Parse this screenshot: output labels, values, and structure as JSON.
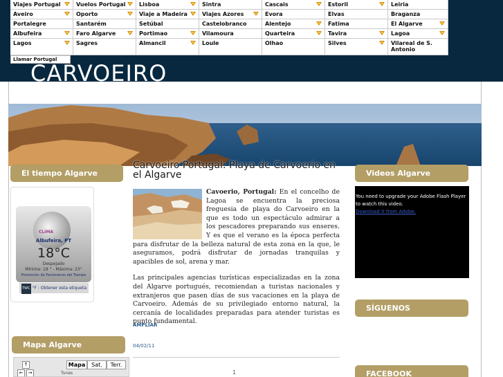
{
  "menu": {
    "rows": [
      [
        {
          "label": "Viajes Portugal",
          "arrow": true
        },
        {
          "label": "Vuelos Portugal",
          "arrow": true
        },
        {
          "label": "Lisboa",
          "arrow": true
        },
        {
          "label": "Sintra",
          "arrow": false
        },
        {
          "label": "Cascais",
          "arrow": true
        },
        {
          "label": "Estoril",
          "arrow": true
        },
        {
          "label": "Leiria",
          "arrow": false
        }
      ],
      [
        {
          "label": "Aveiro",
          "arrow": true
        },
        {
          "label": "Oporto",
          "arrow": true
        },
        {
          "label": "Viaje a Madeira",
          "arrow": true
        },
        {
          "label": "Viajes Azores",
          "arrow": true
        },
        {
          "label": "Evora",
          "arrow": false
        },
        {
          "label": "Elvas",
          "arrow": false
        },
        {
          "label": "Braganza",
          "arrow": false
        }
      ],
      [
        {
          "label": "Portalegre",
          "arrow": false
        },
        {
          "label": "Santarém",
          "arrow": false
        },
        {
          "label": "Setúbal",
          "arrow": false
        },
        {
          "label": "Castelobranco",
          "arrow": false
        },
        {
          "label": "Alentejo",
          "arrow": true
        },
        {
          "label": "Fatima",
          "arrow": false
        },
        {
          "label": "El Algarve",
          "arrow": true
        }
      ],
      [
        {
          "label": "Albufeira",
          "arrow": true
        },
        {
          "label": "Faro Algarve",
          "arrow": true
        },
        {
          "label": "Portimao",
          "arrow": true
        },
        {
          "label": "Vilamoura",
          "arrow": false
        },
        {
          "label": "Quarteira",
          "arrow": true
        },
        {
          "label": "Tavira",
          "arrow": true
        },
        {
          "label": "Lagoa",
          "arrow": true
        }
      ],
      [
        {
          "label": "Lagos",
          "arrow": true
        },
        {
          "label": "Sagres",
          "arrow": false
        },
        {
          "label": "Almancil",
          "arrow": true
        },
        {
          "label": "Loule",
          "arrow": false
        },
        {
          "label": "Olhao",
          "arrow": false
        },
        {
          "label": "Silves",
          "arrow": true
        },
        {
          "label": "Vilareal de S. Antonio",
          "arrow": false
        }
      ]
    ],
    "call_label": "Llamar Portugal"
  },
  "site_title": "CARVOEIRO",
  "banner_subtitle": "Carvoeiro Portugal: Playa de Carvoerio en el Algarve",
  "left": {
    "weather_title": "El tiempo Algarve",
    "weather": {
      "brand": "CLIMA",
      "city": "Albufeira, PT",
      "temp": "18°C",
      "condition": "Despejado",
      "minmax": "Mínima: 18 ° - Máxima: 23°",
      "powered": "Promoción de Fenómenos del Tiempo",
      "footer_badge": "TWC",
      "footer_text": "°F : Obtener esta etiqueta"
    },
    "map_title": "Mapa Algarve",
    "map": {
      "btn_map": "Mapa",
      "btn_sat": "Sat.",
      "btn_terrain": "Terr.",
      "place": "Tunes"
    }
  },
  "article": {
    "lead_bold": "Cavoerio, Portugal:",
    "p1": " En el concelho de Lagoa se encuentra la preciosa freguesia de playa do Carvoeiro en la que es todo un espectáculo admirar a los pescadores preparando sus enseres. Y es que el verano es la época perfecta para disfrutar de la belleza natural de esta zona en la que, le aseguramos, podrá disfrutar de jornadas tranquilas y apacibles de sol, arena y mar.",
    "p2": "Las principales agencias turísticas especializadas en la zona del Algarve portugués, recomiendan a turistas nacionales y extranjeros que pasen días de sus vacaciones en la playa de Carvoeiro. Además de su privilegiado entorno natural, la cercanía de localidades preparadas para atender turistas es punto fundamental.",
    "more": "AMPLIAR",
    "date": "04/02/11",
    "page": "1"
  },
  "right": {
    "videos_title": "Videos Algarve",
    "flash_msg": "You need to upgrade your Adobe Flash Player to watch this video.",
    "flash_link": "Download it from Adobe.",
    "follow_title": "SÍGUENOS",
    "facebook_title": "FACEBOOK"
  },
  "colors": {
    "header_bg": "#08283f",
    "section_head": "#b39e66",
    "arrow": "#d48a00"
  }
}
